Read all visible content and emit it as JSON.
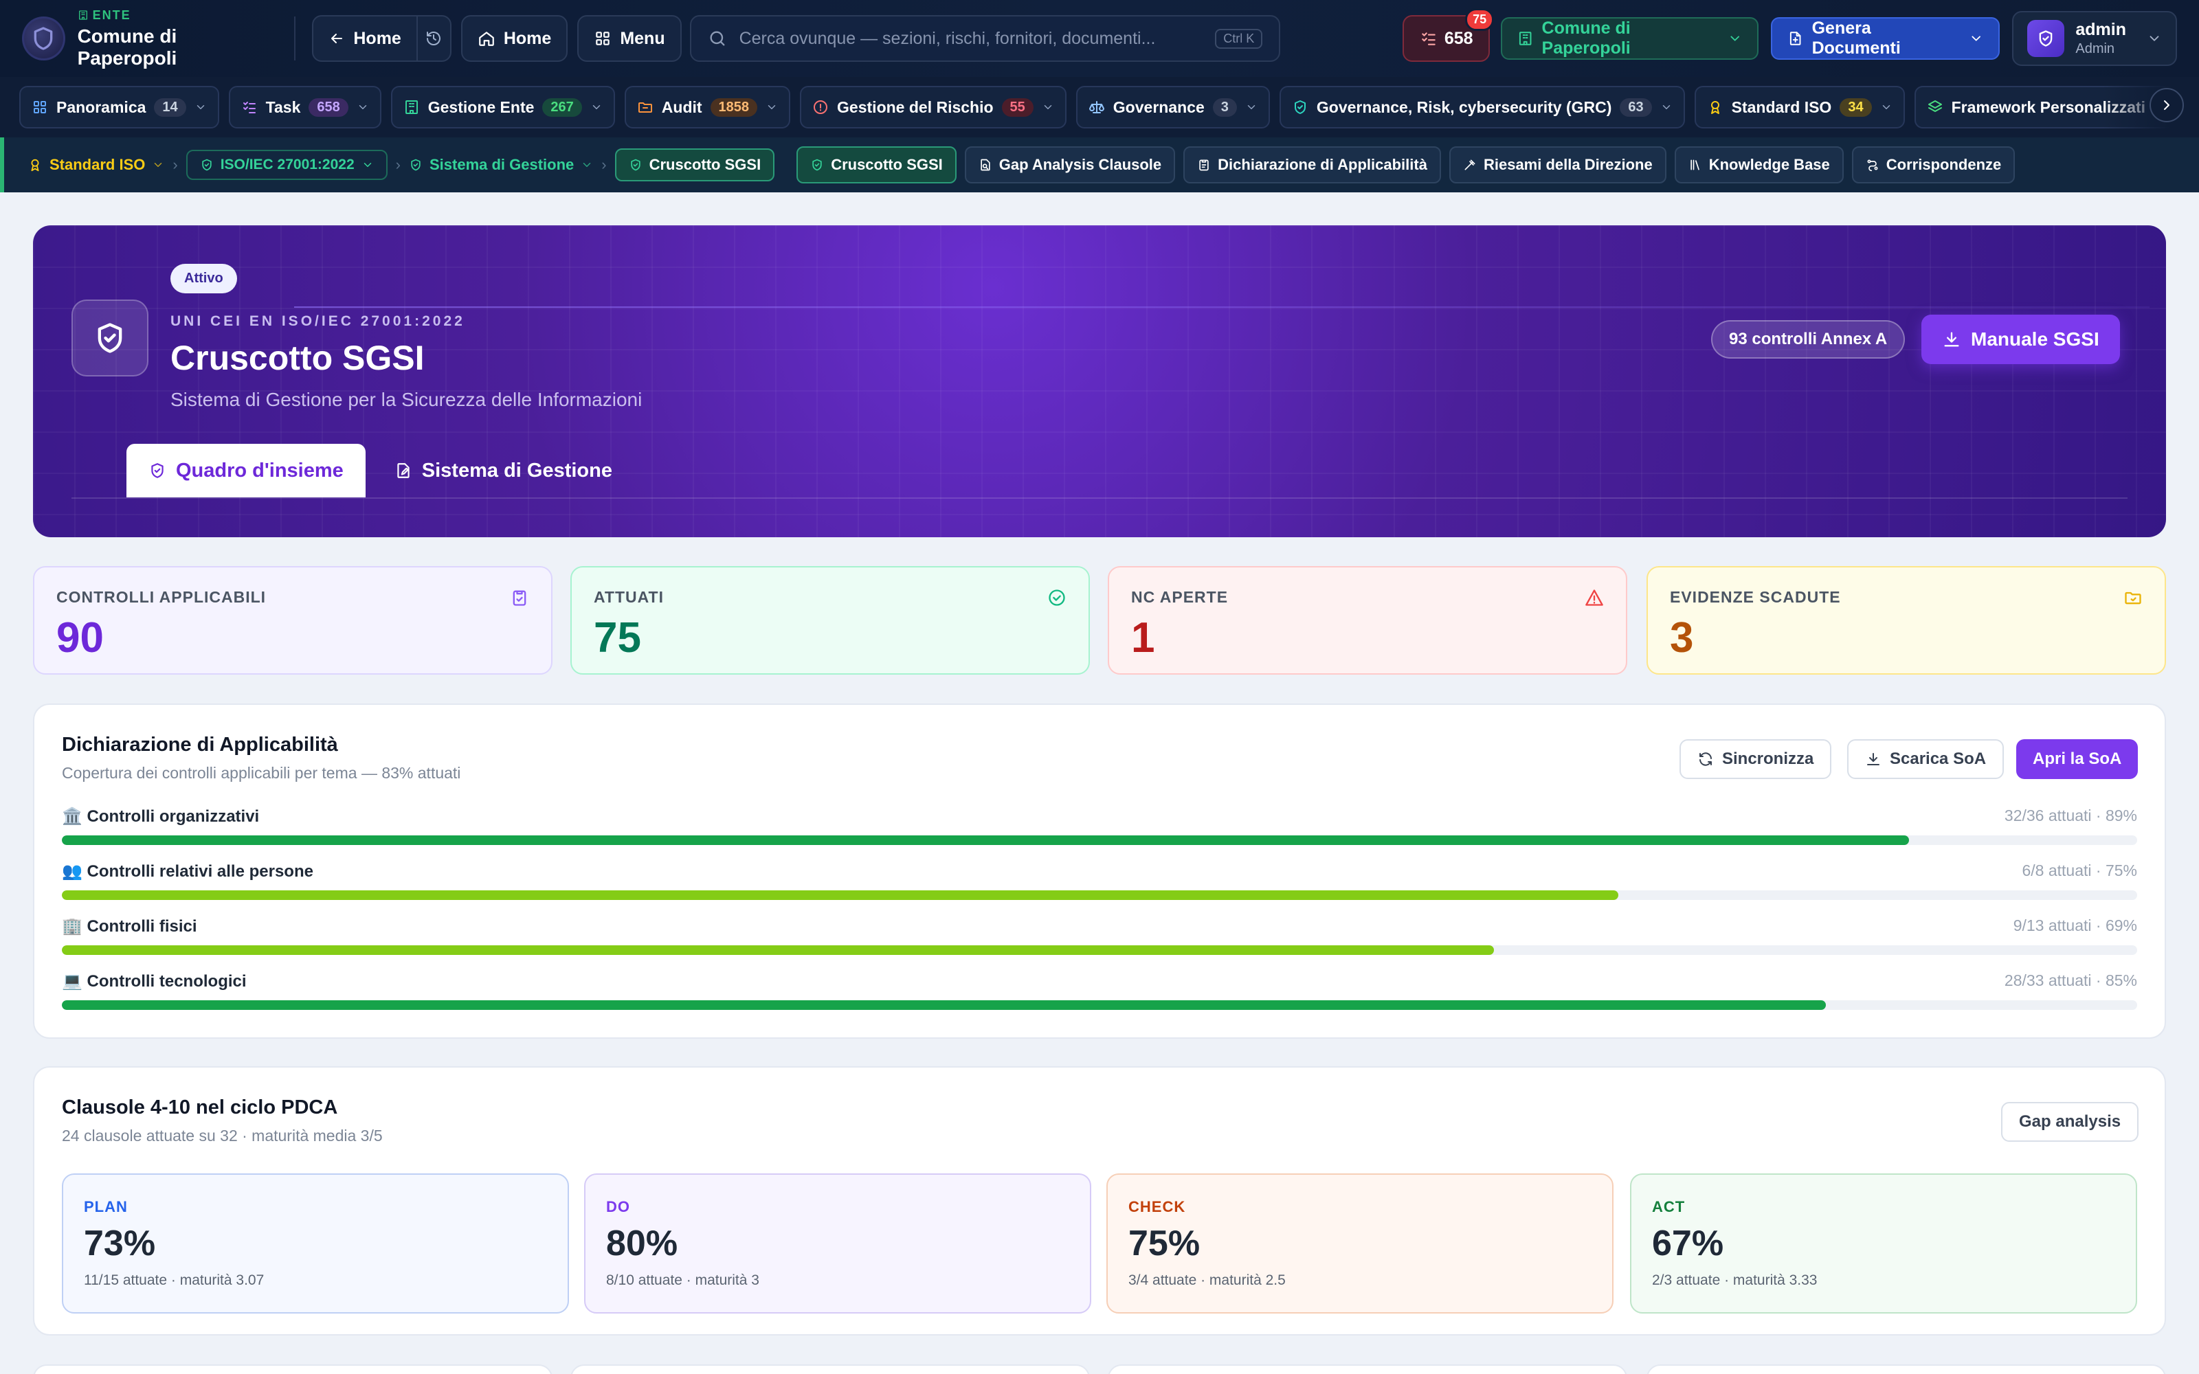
{
  "topbar": {
    "ente_label": "ENTE",
    "ente_name": "Comune di Paperopoli",
    "back_home": "Home",
    "home": "Home",
    "menu": "Menu",
    "search_placeholder": "Cerca ovunque — sezioni, rischi, fornitori, documenti...",
    "search_shortcut": "Ctrl K",
    "tasks_count": "658",
    "tasks_badge": "75",
    "org_select": "Comune di Paperopoli",
    "generate": "Genera Documenti",
    "user_name": "admin",
    "user_role": "Admin"
  },
  "modules": [
    {
      "label": "Panoramica",
      "count": "14",
      "icon": "grid-icon",
      "color": "#60a5fa",
      "count_bg": "#2a3550",
      "count_color": "#cbd5e1"
    },
    {
      "label": "Task",
      "count": "658",
      "icon": "checklist-icon",
      "color": "#c084fc",
      "count_bg": "#3b2a63",
      "count_color": "#c4a7ff"
    },
    {
      "label": "Gestione Ente",
      "count": "267",
      "icon": "building-icon",
      "color": "#34d399",
      "count_bg": "#174a3c",
      "count_color": "#4ade80"
    },
    {
      "label": "Audit",
      "count": "1858",
      "icon": "folder-icon",
      "color": "#fb923c",
      "count_bg": "#4a3120",
      "count_color": "#fdba74"
    },
    {
      "label": "Gestione del Rischio",
      "count": "55",
      "icon": "alert-circle-icon",
      "color": "#f87171",
      "count_bg": "#4b1d2a",
      "count_color": "#fb7185"
    },
    {
      "label": "Governance",
      "count": "3",
      "icon": "scale-icon",
      "color": "#93c5fd",
      "count_bg": "#2a3550",
      "count_color": "#cbd5e1"
    },
    {
      "label": "Governance, Risk, cybersecurity (GRC)",
      "count": "63",
      "icon": "shield-check-icon",
      "color": "#2dd4bf",
      "count_bg": "#2a3550",
      "count_color": "#cbd5e1"
    },
    {
      "label": "Standard ISO",
      "count": "34",
      "icon": "award-icon",
      "color": "#facc15",
      "count_bg": "#4a4020",
      "count_color": "#fde047"
    },
    {
      "label": "Framework Personalizzati",
      "count": "",
      "icon": "layers-icon",
      "color": "#4ade80",
      "count_bg": "#2a3550",
      "count_color": "#cbd5e1"
    }
  ],
  "breadcrumbs": {
    "standard": "Standard ISO",
    "norm": "ISO/IEC 27001:2022",
    "system": "Sistema di Gestione",
    "current": "Cruscotto SGSI",
    "links": [
      "Cruscotto SGSI",
      "Gap Analysis Clausole",
      "Dichiarazione di Applicabilità",
      "Riesami della Direzione",
      "Knowledge Base",
      "Corrispondenze"
    ]
  },
  "hero": {
    "status": "Attivo",
    "kicker": "UNI CEI EN ISO/IEC 27001:2022",
    "title": "Cruscotto SGSI",
    "subtitle": "Sistema di Gestione per la Sicurezza delle Informazioni",
    "controls_badge": "93 controlli Annex A",
    "manual_button": "Manuale SGSI",
    "tab_overview": "Quadro d'insieme",
    "tab_system": "Sistema di Gestione"
  },
  "kpis": [
    {
      "label": "CONTROLLI APPLICABILI",
      "value": "90",
      "color": "#6d28d9",
      "bg": "#f5f3ff",
      "border": "#ddd6fe",
      "icon": "clipboard-check-icon",
      "icon_color": "#8b5cf6"
    },
    {
      "label": "ATTUATI",
      "value": "75",
      "color": "#047857",
      "bg": "#ecfdf5",
      "border": "#a7f3d0",
      "icon": "check-circle-icon",
      "icon_color": "#10b981"
    },
    {
      "label": "NC APERTE",
      "value": "1",
      "color": "#b91c1c",
      "bg": "#fef2f2",
      "border": "#fecaca",
      "icon": "warning-triangle-icon",
      "icon_color": "#ef4444"
    },
    {
      "label": "EVIDENZE SCADUTE",
      "value": "3",
      "color": "#b45309",
      "bg": "#fefce8",
      "border": "#fde68a",
      "icon": "folder-clock-icon",
      "icon_color": "#eab308"
    }
  ],
  "soa": {
    "title": "Dichiarazione di Applicabilità",
    "subtitle": "Copertura dei controlli applicabili per tema — 83% attuati",
    "sync_button": "Sincronizza",
    "download_button": "Scarica SoA",
    "open_button": "Apri la SoA",
    "rows": [
      {
        "label": "🏛️ Controlli organizzativi",
        "stat": "32/36 attuati · 89%",
        "pct": 89,
        "color": "#16a34a"
      },
      {
        "label": "👥 Controlli relativi alle persone",
        "stat": "6/8 attuati · 75%",
        "pct": 75,
        "color": "#84cc16"
      },
      {
        "label": "🏢 Controlli fisici",
        "stat": "9/13 attuati · 69%",
        "pct": 69,
        "color": "#84cc16"
      },
      {
        "label": "💻 Controlli tecnologici",
        "stat": "28/33 attuati · 85%",
        "pct": 85,
        "color": "#16a34a"
      }
    ]
  },
  "pdca": {
    "title": "Clausole 4-10 nel ciclo PDCA",
    "subtitle": "24 clausole attuate su 32 · maturità media 3/5",
    "gap_button": "Gap analysis",
    "phases": [
      {
        "key": "PLAN",
        "value": "73%",
        "meta": "11/15 attuate · maturità 3.07",
        "color": "#2563eb",
        "bg": "#f5f8ff",
        "border": "#bfd0f5"
      },
      {
        "key": "DO",
        "value": "80%",
        "meta": "8/10 attuate · maturità 3",
        "color": "#7c3aed",
        "bg": "#f7f4ff",
        "border": "#d6cbf7"
      },
      {
        "key": "CHECK",
        "value": "75%",
        "meta": "3/4 attuate · maturità 2.5",
        "color": "#c2410c",
        "bg": "#fff6f1",
        "border": "#f6cfb7"
      },
      {
        "key": "ACT",
        "value": "67%",
        "meta": "2/3 attuate · maturità 3.33",
        "color": "#15803d",
        "bg": "#f3fbf5",
        "border": "#bfe5c9"
      }
    ]
  }
}
